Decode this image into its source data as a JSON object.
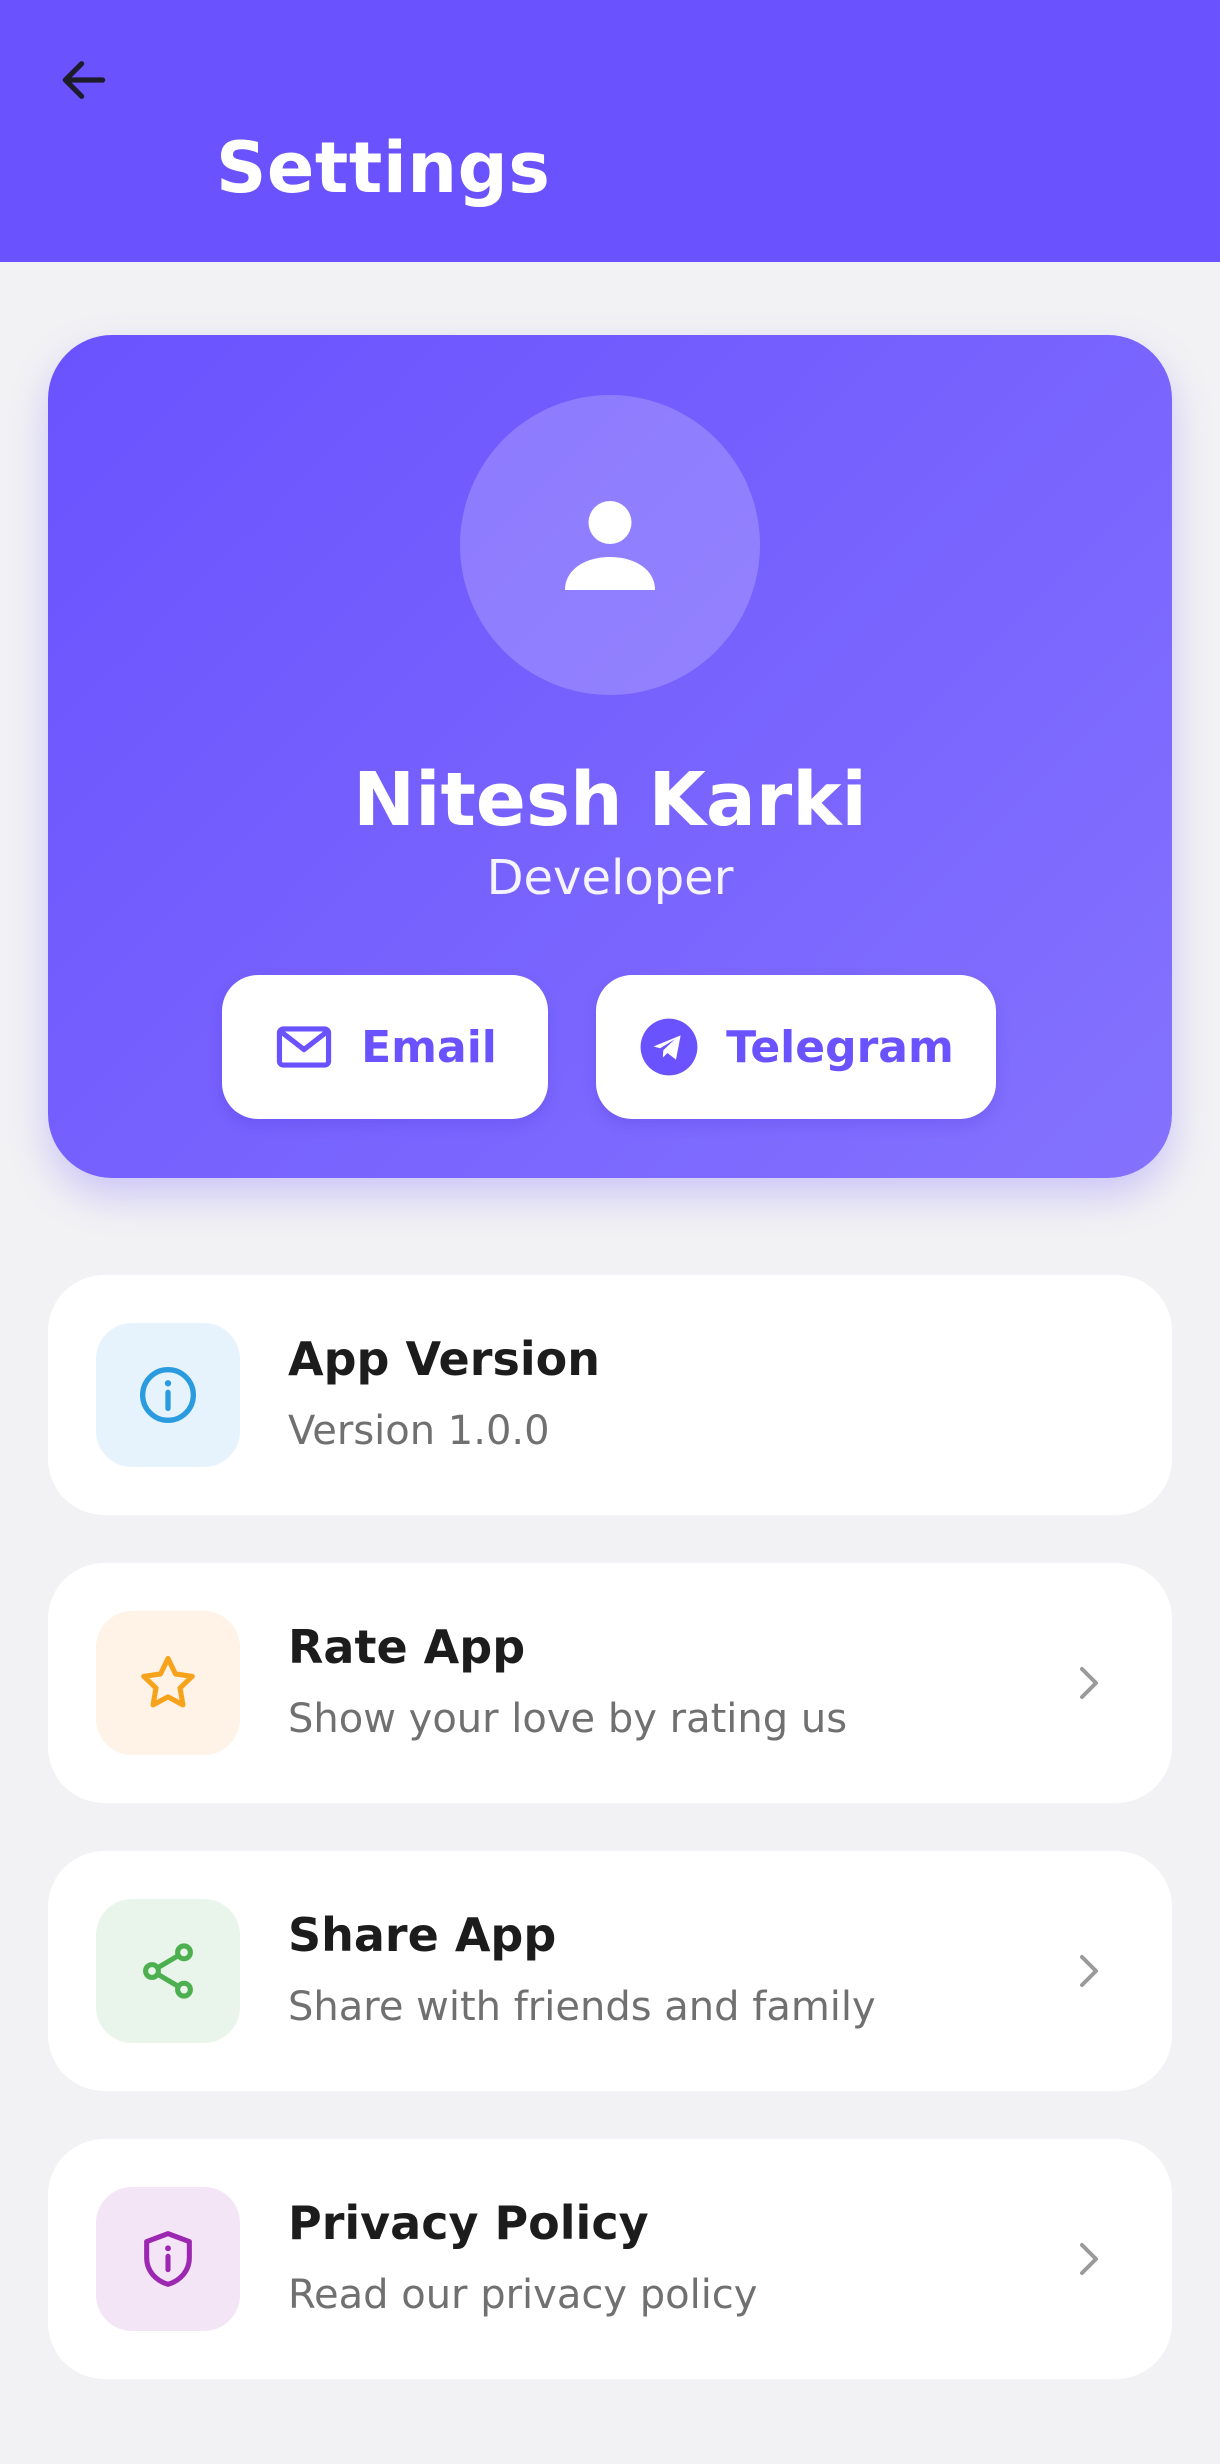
{
  "app_bar": {
    "title": "Settings",
    "back_icon": "arrow-left-icon"
  },
  "profile": {
    "avatar_icon": "person-icon",
    "name": "Nitesh Karki",
    "role": "Developer",
    "contacts": [
      {
        "label": "Email",
        "icon": "mail-icon"
      },
      {
        "label": "Telegram",
        "icon": "telegram-icon"
      }
    ]
  },
  "items": [
    {
      "title": "App Version",
      "subtitle": "Version 1.0.0",
      "icon": "info-icon",
      "has_chevron": false
    },
    {
      "title": "Rate App",
      "subtitle": "Show your love by rating us",
      "icon": "star-icon",
      "has_chevron": true
    },
    {
      "title": "Share App",
      "subtitle": "Share with friends and family",
      "icon": "share-icon",
      "has_chevron": true
    },
    {
      "title": "Privacy Policy",
      "subtitle": "Read our privacy policy",
      "icon": "shield-icon",
      "has_chevron": true
    }
  ],
  "colors": {
    "primary": "#6a52fe",
    "background": "#f2f2f4",
    "info": "#2b9be0",
    "info_bg": "#e6f3fd",
    "star": "#f7a21b",
    "star_bg": "#fef3e6",
    "share": "#4caf50",
    "share_bg": "#e9f5ea",
    "shield": "#9c27b0",
    "shield_bg": "#f3e5f6"
  }
}
